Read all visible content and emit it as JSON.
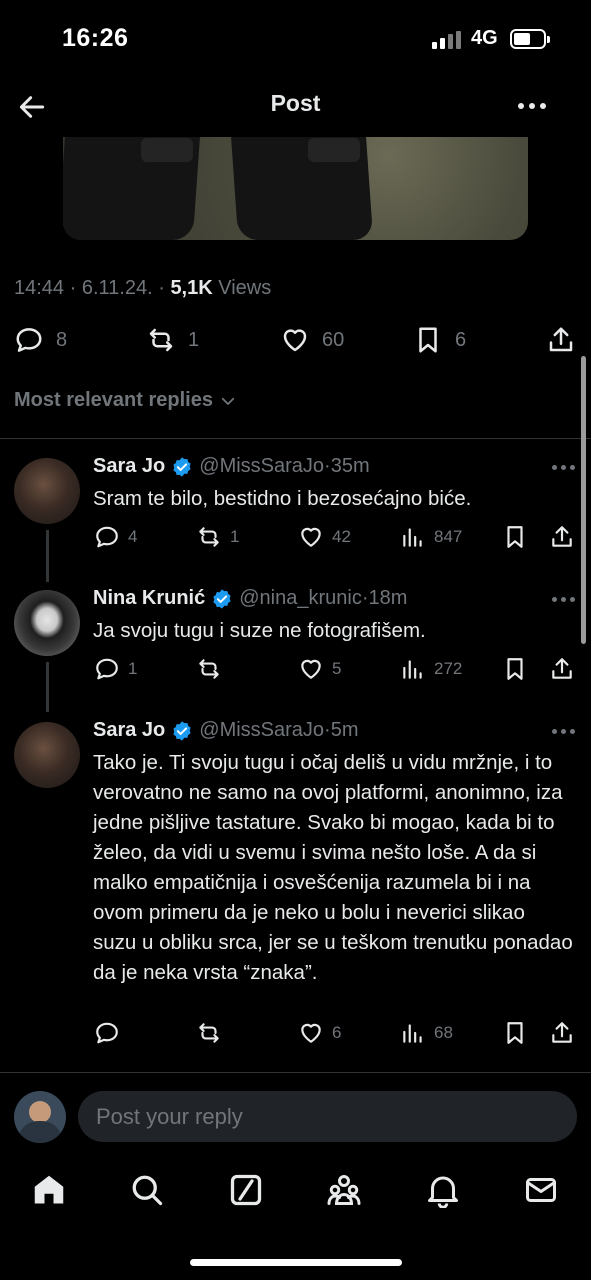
{
  "status_bar": {
    "time": "16:26",
    "network": "4G"
  },
  "header": {
    "title": "Post"
  },
  "post": {
    "time": "14:44",
    "date": "6.11.24.",
    "views_count": "5,1K",
    "views_label": "Views",
    "stats": {
      "replies": "8",
      "reposts": "1",
      "likes": "60",
      "bookmarks": "6"
    }
  },
  "sort": {
    "label": "Most relevant replies"
  },
  "replies": [
    {
      "name": "Sara Jo",
      "handle": "@MissSaraJo",
      "time": "35m",
      "text": "Sram te bilo, bestidno i bezosećajno biće.",
      "replies": "4",
      "reposts": "1",
      "likes": "42",
      "views": "847"
    },
    {
      "name": "Nina Krunić",
      "handle": "@nina_krunic",
      "time": "18m",
      "text": "Ja svoju tugu i suze ne fotografišem.",
      "replies": "1",
      "reposts": "",
      "likes": "5",
      "views": "272"
    },
    {
      "name": "Sara Jo",
      "handle": "@MissSaraJo",
      "time": "5m",
      "text": "Tako je. Ti svoju tugu i očaj deliš u vidu mržnje, i to verovatno ne samo na ovoj platformi, anonimno, iza jedne pišljive tastature. Svako bi mogao, kada bi to želeo, da vidi u svemu i svima nešto loše. A da si malko empatičnija i osvešćenija razumela bi i na ovom primeru da je neko u bolu i neverici slikao suzu u obliku srca, jer se u teškom trenutku ponadao da je neka vrsta “znaka”.",
      "replies": "",
      "reposts": "",
      "likes": "6",
      "views": "68"
    }
  ],
  "composer": {
    "placeholder": "Post your reply"
  },
  "colors": {
    "background": "#000000",
    "text": "#e7e9ea",
    "muted": "#71767b",
    "verified": "#1d9bf0",
    "divider": "#2f3336"
  },
  "icons": [
    "back-arrow-icon",
    "more-icon",
    "reply-icon",
    "repost-icon",
    "like-icon",
    "bookmark-icon",
    "share-icon",
    "views-icon",
    "verified-icon",
    "home-icon",
    "search-icon",
    "grok-icon",
    "communities-icon",
    "notifications-icon",
    "messages-icon"
  ]
}
